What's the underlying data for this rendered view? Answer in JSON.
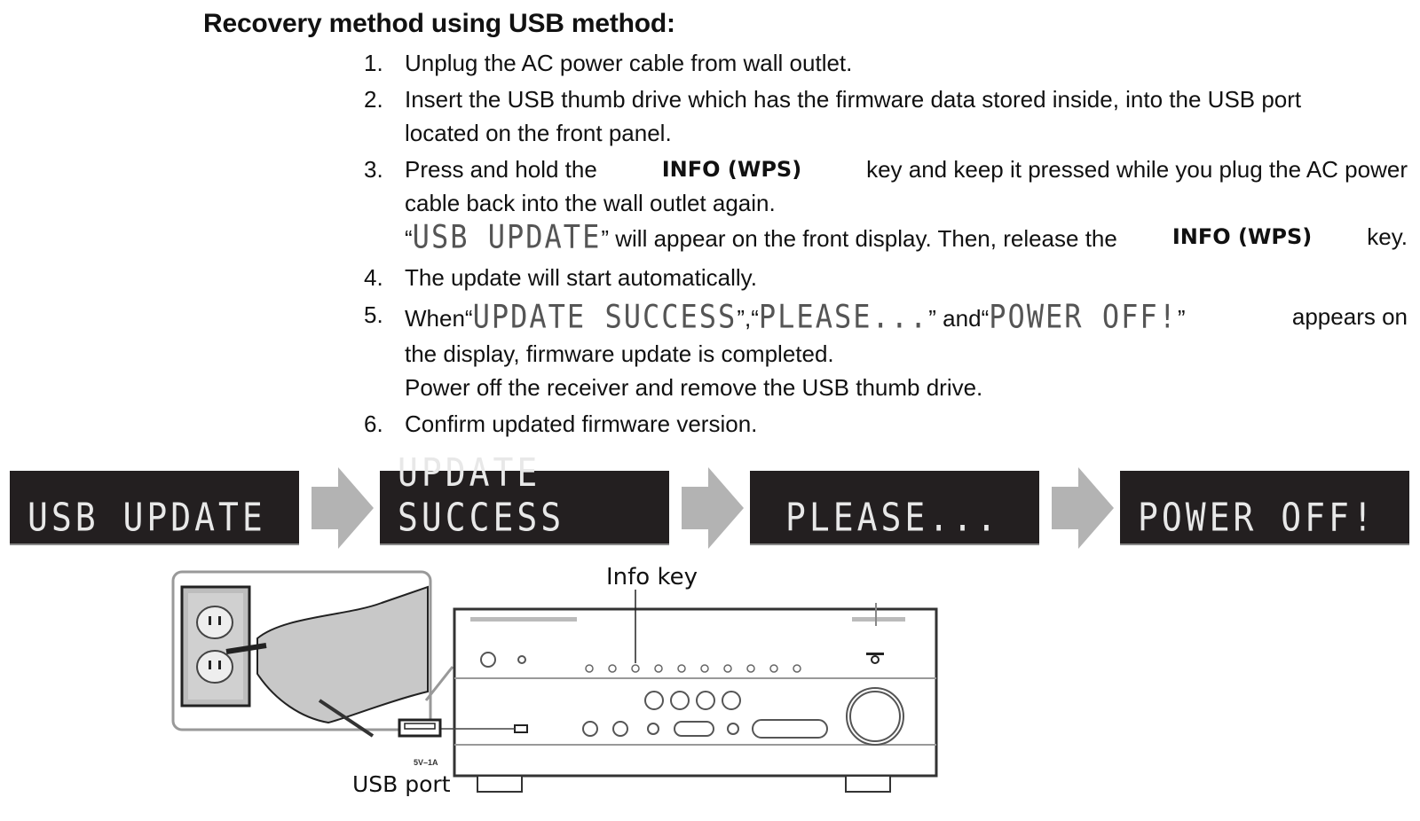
{
  "title": "Recovery method using USB method:",
  "steps": [
    {
      "num": "1.",
      "lines": [
        "Unplug the AC power cable from wall outlet."
      ]
    },
    {
      "num": "2.",
      "lines": [
        "Insert the USB thumb drive which has the firmware data stored inside, into the USB port",
        "located on the front panel."
      ]
    },
    {
      "num": "3.",
      "parts": {
        "a": "Press and hold the",
        "key": "INFO (WPS)",
        "b": "key and keep it pressed while you plug the AC power",
        "c": "cable back into the wall outlet again.",
        "q_open": "“",
        "lcd": "USB UPDATE",
        "q_close": "”",
        "d": "will appear on the front display. Then, release the",
        "key2": "INFO (WPS)",
        "e": "key."
      }
    },
    {
      "num": "4.",
      "lines": [
        "The update will start automatically."
      ]
    },
    {
      "num": "5.",
      "parts": {
        "a": "When",
        "lcd1": "UPDATE SUCCESS",
        "sep": ",",
        "lcd2": "PLEASE...",
        "and": "and",
        "lcd3": "POWER OFF!",
        "b": "appears on",
        "c": "the display, firmware update is completed.",
        "d": "Power off the receiver and remove the USB thumb drive."
      }
    },
    {
      "num": "6.",
      "lines": [
        "Confirm updated firmware version."
      ]
    }
  ],
  "display_sequence": [
    "USB UPDATE",
    "UPDATE SUCCESS",
    "PLEASE...",
    "POWER OFF!"
  ],
  "figure": {
    "info_key_label": "Info key",
    "usb_port_label": "USB port",
    "usb_rating": "5V–1A"
  },
  "colors": {
    "lcd_bg": "#231f20",
    "lcd_text": "#e8e8e8",
    "arrow": "#b3b3b3"
  }
}
